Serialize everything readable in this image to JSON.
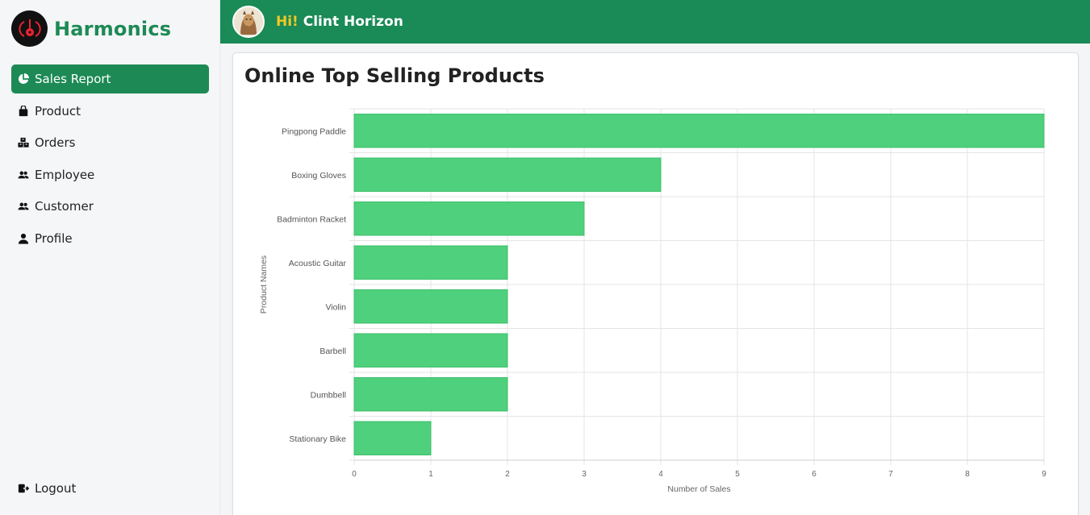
{
  "app": {
    "name": "Harmonics",
    "accent": "#1d8a55"
  },
  "sidebar": {
    "items": [
      {
        "label": "Sales Report",
        "icon": "pie-chart-icon",
        "active": true
      },
      {
        "label": "Product",
        "icon": "bag-icon",
        "active": false
      },
      {
        "label": "Orders",
        "icon": "boxes-icon",
        "active": false
      },
      {
        "label": "Employee",
        "icon": "users-icon",
        "active": false
      },
      {
        "label": "Customer",
        "icon": "users-icon",
        "active": false
      },
      {
        "label": "Profile",
        "icon": "person-icon",
        "active": false
      }
    ],
    "logout": "Logout"
  },
  "header": {
    "hi": "Hi!",
    "user": "Clint Horizon"
  },
  "card": {
    "title": "Online Top Selling Products"
  },
  "chart_data": {
    "type": "bar",
    "orientation": "horizontal",
    "categories": [
      "Pingpong Paddle",
      "Boxing Gloves",
      "Badminton Racket",
      "Acoustic Guitar",
      "Violin",
      "Barbell",
      "Dumbbell",
      "Stationary Bike"
    ],
    "values": [
      9,
      4,
      3,
      2,
      2,
      2,
      2,
      1
    ],
    "xlabel": "Number of Sales",
    "ylabel": "Product Names",
    "xlim": [
      0,
      9
    ],
    "xticks": [
      0,
      1,
      2,
      3,
      4,
      5,
      6,
      7,
      8,
      9
    ],
    "bar_color": "#4fd07c",
    "grid": true
  }
}
